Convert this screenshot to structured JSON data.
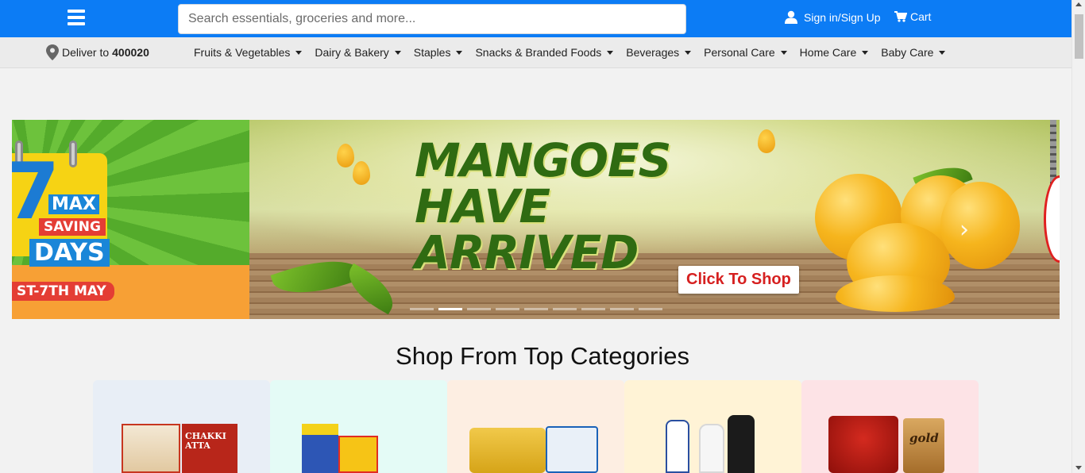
{
  "header": {
    "search_placeholder": "Search essentials, groceries and more...",
    "signin_label": "Sign in/Sign Up",
    "cart_label": "Cart"
  },
  "nav": {
    "deliver_prefix": "Deliver to",
    "pincode": "400020",
    "categories": [
      "Fruits & Vegetables",
      "Dairy & Bakery",
      "Staples",
      "Snacks & Branded Foods",
      "Beverages",
      "Personal Care",
      "Home Care",
      "Baby Care"
    ]
  },
  "banner": {
    "promo_left": {
      "number": "7",
      "max": "MAX",
      "saving": "SAVING",
      "days": "DAYS",
      "dates": "ST-7TH MAY"
    },
    "headline_line1": "MANGOES",
    "headline_line2": "HAVE",
    "headline_line3": "ARRIVED",
    "cta": "Click To Shop",
    "slide_count": 9,
    "active_slide": 1
  },
  "categories_section": {
    "title": "Shop From Top Categories",
    "tile_colors": [
      "#e8eef6",
      "#e4fbf6",
      "#fdeee2",
      "#fff3d6",
      "#fde3e6"
    ],
    "product_text": {
      "atta": "CHAKKI ATTA",
      "tea": "gold"
    }
  },
  "colors": {
    "header_bg": "#0c7cf5",
    "nav_bg": "#ebebeb",
    "page_bg": "#f2f2f2",
    "cta_text": "#d62020"
  }
}
